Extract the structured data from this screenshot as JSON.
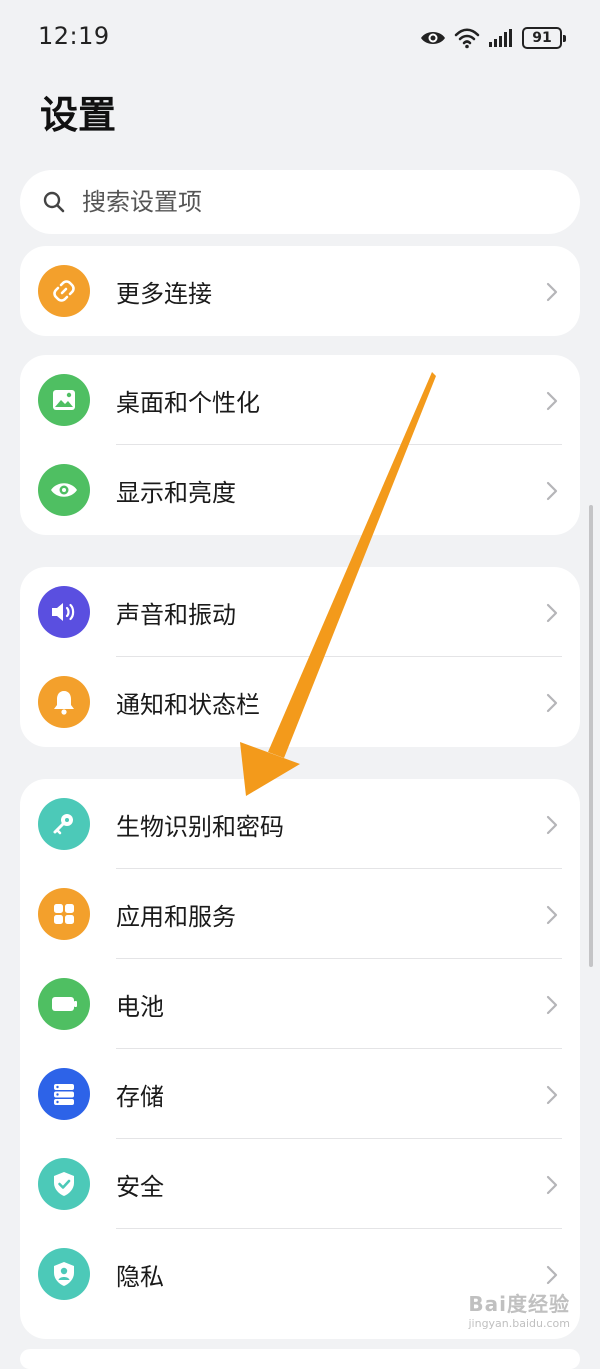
{
  "status_bar": {
    "time": "12:19",
    "battery": "91",
    "icons": [
      "eye-icon",
      "wifi-icon",
      "signal-icon",
      "battery-icon"
    ]
  },
  "page": {
    "title": "设置"
  },
  "search": {
    "placeholder": "搜索设置项"
  },
  "groups": [
    {
      "items": [
        {
          "label": "更多连接",
          "icon": "link-icon",
          "color": "#f3a02c"
        }
      ]
    },
    {
      "items": [
        {
          "label": "桌面和个性化",
          "icon": "image-icon",
          "color": "#4fbf62"
        },
        {
          "label": "显示和亮度",
          "icon": "eye-icon",
          "color": "#4fbf62"
        }
      ]
    },
    {
      "items": [
        {
          "label": "声音和振动",
          "icon": "speaker-icon",
          "color": "#5a4fe0"
        },
        {
          "label": "通知和状态栏",
          "icon": "bell-icon",
          "color": "#f3a02c"
        }
      ]
    },
    {
      "items": [
        {
          "label": "生物识别和密码",
          "icon": "key-icon",
          "color": "#4cc9b8"
        },
        {
          "label": "应用和服务",
          "icon": "apps-grid-icon",
          "color": "#f3a02c"
        },
        {
          "label": "电池",
          "icon": "battery-icon",
          "color": "#4fbf62"
        },
        {
          "label": "存储",
          "icon": "storage-icon",
          "color": "#2d63e8"
        },
        {
          "label": "安全",
          "icon": "shield-check-icon",
          "color": "#4cc9b8"
        },
        {
          "label": "隐私",
          "icon": "privacy-shield-icon",
          "color": "#4cc9b8"
        }
      ]
    }
  ],
  "annotation": {
    "arrow_color": "#f39a1b"
  },
  "watermark": {
    "main": "Bai度经验",
    "sub": "jingyan.baidu.com"
  }
}
